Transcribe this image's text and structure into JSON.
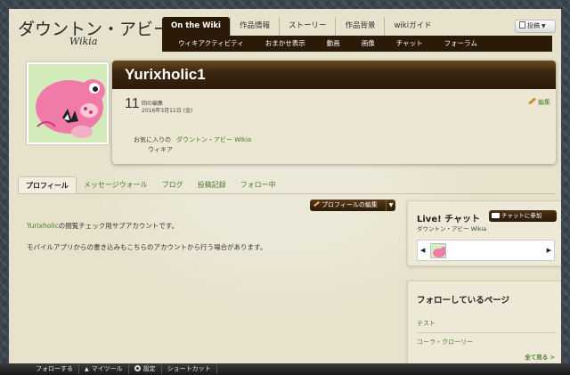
{
  "header": {
    "logo_title": "ダウントン・アビー",
    "logo_sub": "Wikia",
    "contribute_label": "投稿",
    "nav_tabs": [
      {
        "label": "On the Wiki"
      },
      {
        "label": "作品情報"
      },
      {
        "label": "ストーリー"
      },
      {
        "label": "作品背景"
      },
      {
        "label": "wikiガイド"
      }
    ],
    "nav_sub": [
      {
        "label": "ウィキアクティビティ"
      },
      {
        "label": "おまかせ表示"
      },
      {
        "label": "動画"
      },
      {
        "label": "画像"
      },
      {
        "label": "チャット"
      },
      {
        "label": "フォーラム"
      }
    ]
  },
  "masthead": {
    "username": "Yurixholic1",
    "edit_count": "11",
    "edit_label": "回の編集",
    "edit_date": "2016年3月11日 (金)",
    "edit_link": "編集",
    "fav_label": "お気に入りの",
    "fav_label2": "ウィキア",
    "fav_wiki": "ダウントン・アビー Wikia"
  },
  "tabs": [
    {
      "label": "プロフィール"
    },
    {
      "label": "メッセージウォール"
    },
    {
      "label": "ブログ"
    },
    {
      "label": "投稿記録"
    },
    {
      "label": "フォロー中"
    }
  ],
  "profile": {
    "edit_button": "プロフィールの編集",
    "bio_link": "Yurixholic",
    "bio_line1_rest": "の閲覧チェック用サブアカウントです。",
    "bio_line2": "モバイルアプリからの書き込みもこちらのアカウントから行う場合があります。"
  },
  "chat": {
    "title": "Live! チャット",
    "wiki": "ダウントン・アビー Wikia",
    "join_button": "チャットに参加",
    "prev_arrow": "◀",
    "next_arrow": "▶"
  },
  "following": {
    "title": "フォローしているページ",
    "items": [
      "テスト",
      "コーラ・クローリー"
    ],
    "see_all": "全て見る >"
  },
  "toolbar": {
    "follow": "フォローする",
    "mytools": "マイツール",
    "settings": "設定",
    "shortcuts": "ショートカット"
  }
}
